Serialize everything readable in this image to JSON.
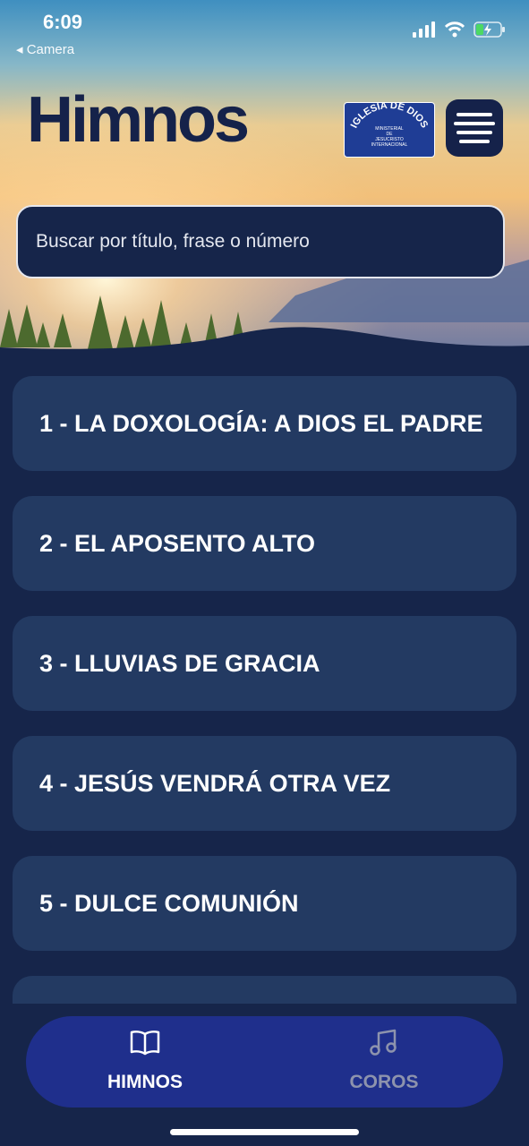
{
  "status_bar": {
    "time": "6:09",
    "back_label": "◂ Camera"
  },
  "header": {
    "title": "Himnos",
    "logo_arc": "IGLESIA DE DIOS",
    "logo_lines": [
      "MINISTERIAL",
      "DE",
      "JESUCRISTO",
      "INTERNACIONAL"
    ]
  },
  "search": {
    "placeholder": "Buscar por título, frase o número",
    "value": ""
  },
  "hymns": [
    "1 - LA DOXOLOGÍA: A DIOS EL PADRE",
    "2 - EL APOSENTO ALTO",
    "3 - LLUVIAS DE GRACIA",
    "4 - JESÚS VENDRÁ OTRA VEZ",
    "5 - DULCE COMUNIÓN",
    ""
  ],
  "tabs": [
    {
      "label": "HIMNOS",
      "icon": "book-icon",
      "active": true
    },
    {
      "label": "COROS",
      "icon": "music-note-icon",
      "active": false
    }
  ],
  "colors": {
    "background": "#16254a",
    "card": "#233a62",
    "tabbar": "#1f2f8c",
    "title": "#15224a",
    "inactive_tab": "#8d93ad"
  }
}
